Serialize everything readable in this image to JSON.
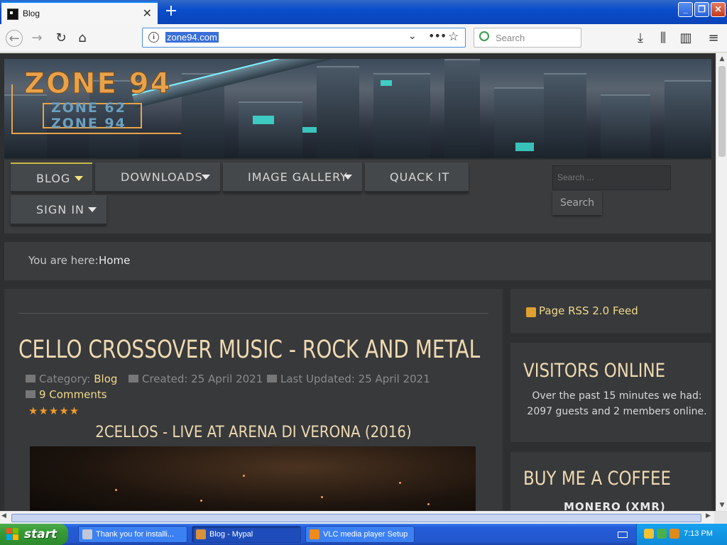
{
  "browser": {
    "tab_title": "Blog",
    "url": "zone94.com",
    "search_placeholder": "Search",
    "new_tab_symbol": "+",
    "close_tab_symbol": "✕"
  },
  "site": {
    "logo_main": "ZONE 94",
    "logo_sub1": "ZONE 62",
    "logo_sub2": "ZONE 94",
    "menu": {
      "blog": "BLOG",
      "downloads": "DOWNLOADS",
      "gallery": "IMAGE GALLERY",
      "quack": "QUACK IT",
      "signin": "SIGN IN"
    },
    "search_placeholder": "Search ...",
    "search_button": "Search",
    "breadcrumb": {
      "prefix": "You are here:",
      "home": "Home"
    },
    "article": {
      "title": "CELLO CROSSOVER MUSIC - ROCK AND METAL",
      "category_label": "Category:",
      "category_value": "Blog",
      "created": "Created: 25 April 2021",
      "updated": "Last Updated: 25 April 2021",
      "comments": "9 Comments",
      "rating_stars": "★★★★★",
      "video_title": "2CELLOS - LIVE AT ARENA DI VERONA (2016)"
    },
    "sidebar": {
      "rss": "Page RSS 2.0 Feed",
      "visitors_heading": "VISITORS ONLINE",
      "visitors_text": "Over the past 15 minutes we had: 2097 guests and 2 members online.",
      "coffee_heading": "BUY ME A COFFEE",
      "coffee_sub": "MONERO (XMR)"
    }
  },
  "taskbar": {
    "start": "start",
    "tasks": [
      "Thank you for installi...",
      "Blog - Mypal",
      "VLC media player Setup"
    ],
    "clock": "7:13 PM"
  },
  "colors": {
    "page_bg": "#2d2f31",
    "accent_gold": "#f2d98a",
    "heading": "#efd9b0",
    "xp_blue": "#245edb",
    "start_green": "#369a36"
  }
}
